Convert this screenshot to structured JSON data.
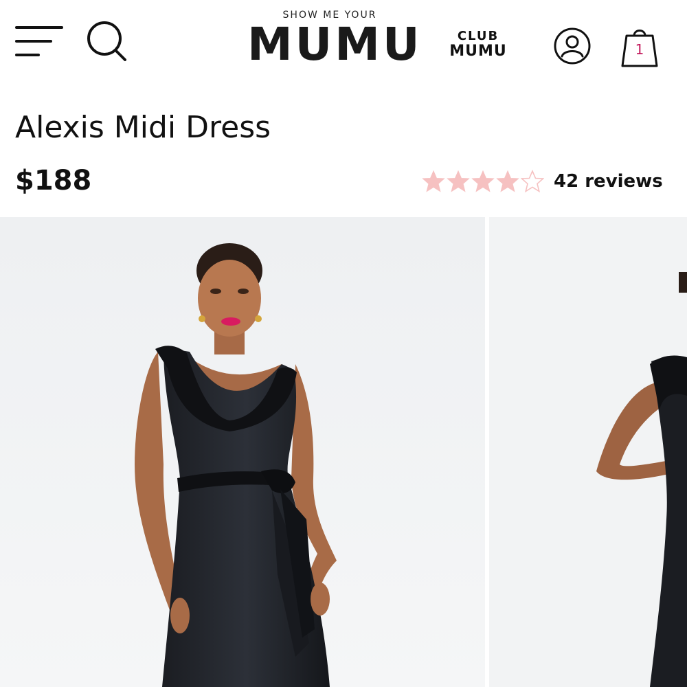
{
  "header": {
    "logo_top": "SHOW ME YOUR",
    "logo_main": "MUMU",
    "club_top": "CLUB",
    "club_main": "MUMU",
    "cart_count": "1",
    "icons": {
      "menu": "hamburger-menu-icon",
      "search": "search-icon",
      "account": "user-icon",
      "cart": "shopping-bag-icon"
    }
  },
  "product": {
    "title": "Alexis Midi Dress",
    "price": "$188",
    "rating": 4,
    "rating_max": 5,
    "reviews_label": "42 reviews"
  },
  "colors": {
    "star_filled": "#f6c1c1",
    "star_empty": "#f6c1c1",
    "accent": "#c2185b",
    "gallery_bg": "#f1f3f5"
  }
}
